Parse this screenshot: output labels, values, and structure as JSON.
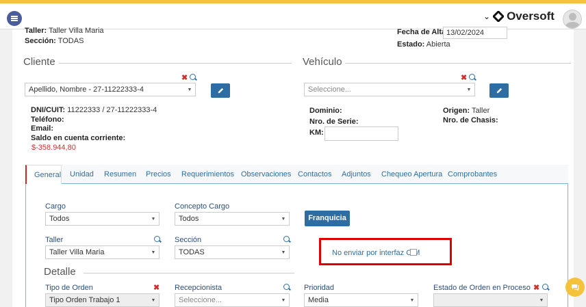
{
  "header": {
    "brand_name": "Oversoft",
    "brand_caret": "⌄"
  },
  "top_info": {
    "taller_label": "Taller:",
    "taller_value": "Taller Villa Maria",
    "seccion_label": "Sección:",
    "seccion_value": "TODAS",
    "fecha_alta_label": "Fecha de Alta:",
    "fecha_alta_value": "13/02/2024",
    "estado_label": "Estado:",
    "estado_value": "Abierta"
  },
  "cliente": {
    "title": "Cliente",
    "select_value": "Apellido, Nombre - 27-11222333-4",
    "dni_label": "DNI/CUIT:",
    "dni_value": "11222333 / 27-11222333-4",
    "telefono_label": "Teléfono:",
    "email_label": "Email:",
    "saldo_label": "Saldo en cuenta corriente:",
    "saldo_value": "$-358.944,80"
  },
  "vehiculo": {
    "title": "Vehículo",
    "select_placeholder": "Seleccione...",
    "dominio_label": "Dominio:",
    "serie_label": "Nro. de Serie:",
    "km_label": "KM:",
    "origen_label": "Origen:",
    "origen_value": "Taller",
    "chasis_label": "Nro. de Chasis:"
  },
  "tabs": [
    {
      "label": "General"
    },
    {
      "label": "Unidad"
    },
    {
      "label": "Resumen"
    },
    {
      "label": "Precios"
    },
    {
      "label": "Requerimientos"
    },
    {
      "label": "Observaciones"
    },
    {
      "label": "Contactos"
    },
    {
      "label": "Adjuntos"
    },
    {
      "label": "Chequeo Apertura"
    },
    {
      "label": "Comprobantes"
    }
  ],
  "general": {
    "cargo_label": "Cargo",
    "cargo_value": "Todos",
    "concepto_label": "Concepto Cargo",
    "concepto_value": "Todos",
    "franquicia_label": "Franquicia",
    "taller_label": "Taller",
    "taller_value": "Taller Villa Maria",
    "seccion_label": "Sección",
    "seccion_value": "TODAS",
    "cim_label": "No enviar por interfaz CIM"
  },
  "detalle": {
    "title": "Detalle",
    "tipo_orden_label": "Tipo de Orden",
    "tipo_orden_value": "Tipo Orden Trabajo 1",
    "recepcionista_label": "Recepcionista",
    "recepcionista_placeholder": "Seleccione...",
    "prioridad_label": "Prioridad",
    "prioridad_value": "Media",
    "estado_proceso_label": "Estado de Orden en Proceso"
  },
  "colors": {
    "accent": "#2e6da4",
    "danger": "#d32f2f",
    "highlight": "#e00000",
    "top_stripe": "#f5c33b"
  }
}
